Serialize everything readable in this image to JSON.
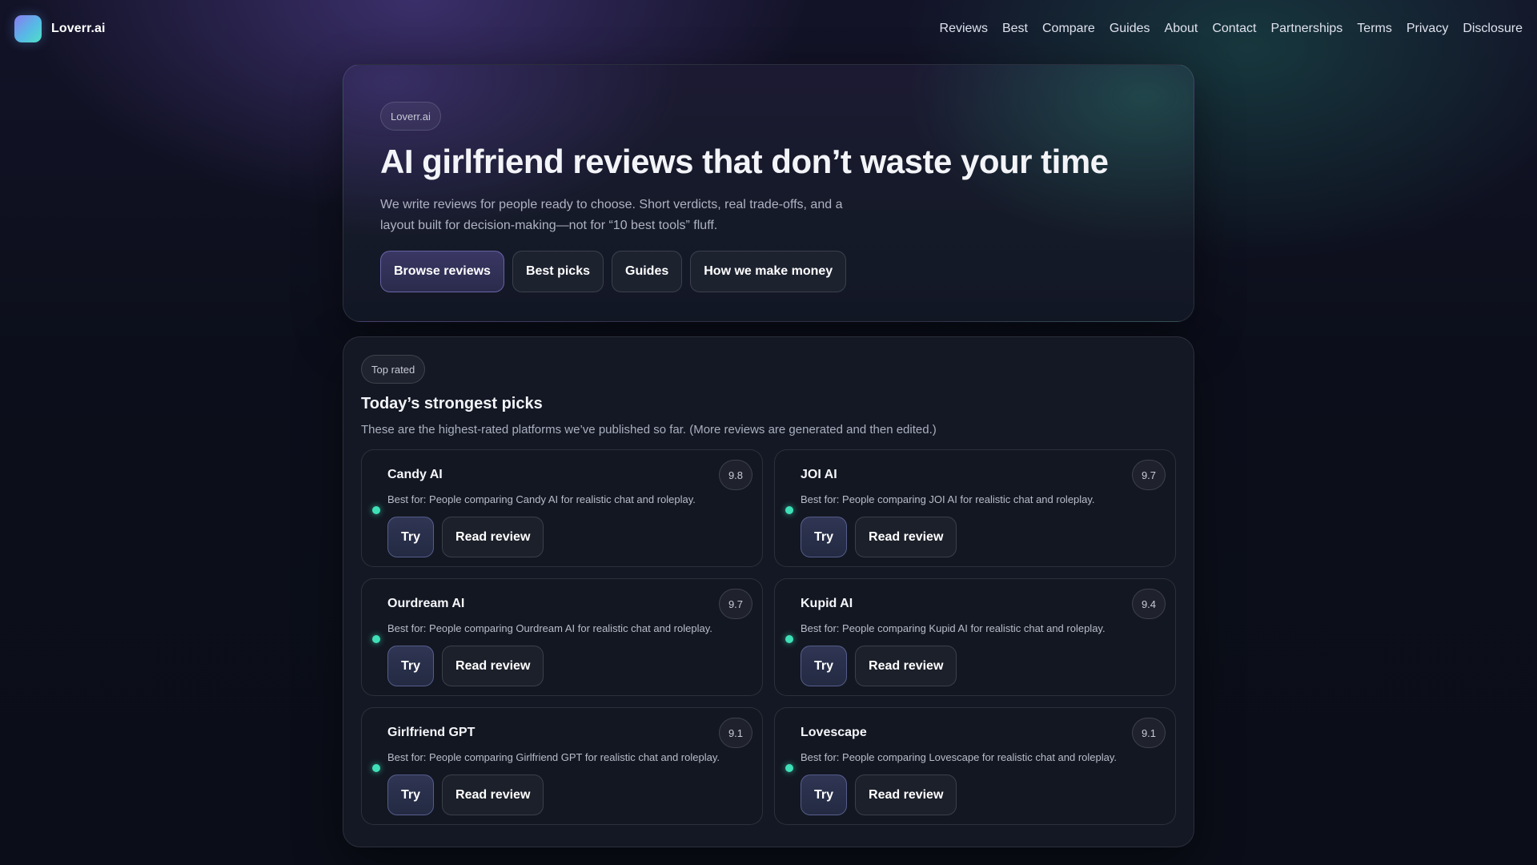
{
  "brand": {
    "name": "Loverr.ai",
    "logo_icon": "gradient-square-logo"
  },
  "nav": {
    "items": [
      "Reviews",
      "Best",
      "Compare",
      "Guides",
      "About",
      "Contact",
      "Partnerships",
      "Terms",
      "Privacy",
      "Disclosure"
    ]
  },
  "hero": {
    "badge": "Loverr.ai",
    "title": "AI girlfriend reviews that don’t waste your time",
    "description": "We write reviews for people ready to choose. Short verdicts, real trade-offs, and a layout built for decision-making—not for “10 best tools” fluff.",
    "buttons": [
      "Browse reviews",
      "Best picks",
      "Guides",
      "How we make money"
    ]
  },
  "picks": {
    "badge": "Top rated",
    "title": "Today’s strongest picks",
    "subtitle": "These are the highest-rated platforms we’ve published so far. (More reviews are generated and then edited.)",
    "try_label": "Try",
    "review_label": "Read review",
    "items": [
      {
        "name": "Candy AI",
        "score": "9.8",
        "desc": "Best for: People comparing Candy AI for realistic chat and roleplay."
      },
      {
        "name": "JOI AI",
        "score": "9.7",
        "desc": "Best for: People comparing JOI AI for realistic chat and roleplay."
      },
      {
        "name": "Ourdream AI",
        "score": "9.7",
        "desc": "Best for: People comparing Ourdream AI for realistic chat and roleplay."
      },
      {
        "name": "Kupid AI",
        "score": "9.4",
        "desc": "Best for: People comparing Kupid AI for realistic chat and roleplay."
      },
      {
        "name": "Girlfriend GPT",
        "score": "9.1",
        "desc": "Best for: People comparing Girlfriend GPT for realistic chat and roleplay."
      },
      {
        "name": "Lovescape",
        "score": "9.1",
        "desc": "Best for: People comparing Lovescape for realistic chat and roleplay."
      }
    ]
  },
  "colors": {
    "accent_dot": "#3fe0b8",
    "primary_button_border": "#968ce6",
    "background": "#0b0e18"
  }
}
